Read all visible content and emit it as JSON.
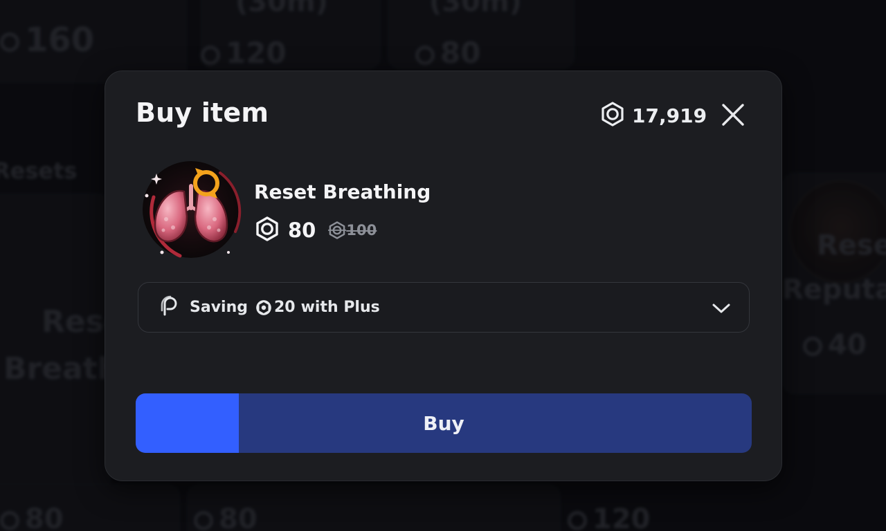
{
  "background": {
    "prices": [
      "160",
      "120",
      "80",
      "80",
      "80",
      "120"
    ],
    "item_labels_top": [
      "(30m)",
      "(30m)"
    ],
    "section_label": "Resets",
    "cards": [
      {
        "name_line1": "Reset",
        "name_line2": "Breathi"
      },
      {
        "name_line1": "Reset",
        "name_line2": "Reputat",
        "price": "40"
      }
    ]
  },
  "modal": {
    "title": "Buy item",
    "balance": "17,919",
    "close_icon": "close-icon",
    "item": {
      "name": "Reset Breathing",
      "price": "80",
      "original_price": "100",
      "image_icon": "lungs-reset-icon"
    },
    "plus_offer": {
      "text_prefix": "Saving",
      "amount": "20",
      "text_suffix": "with Plus",
      "icon": "plus-logo-icon"
    },
    "buy": {
      "label": "Buy",
      "hold_progress": 0.167
    }
  },
  "colors": {
    "modal_bg": "#1c1d21",
    "buy_base": "#27397f",
    "buy_progress": "#335fff",
    "text": "#f4f4f6",
    "muted": "#8d9098"
  }
}
